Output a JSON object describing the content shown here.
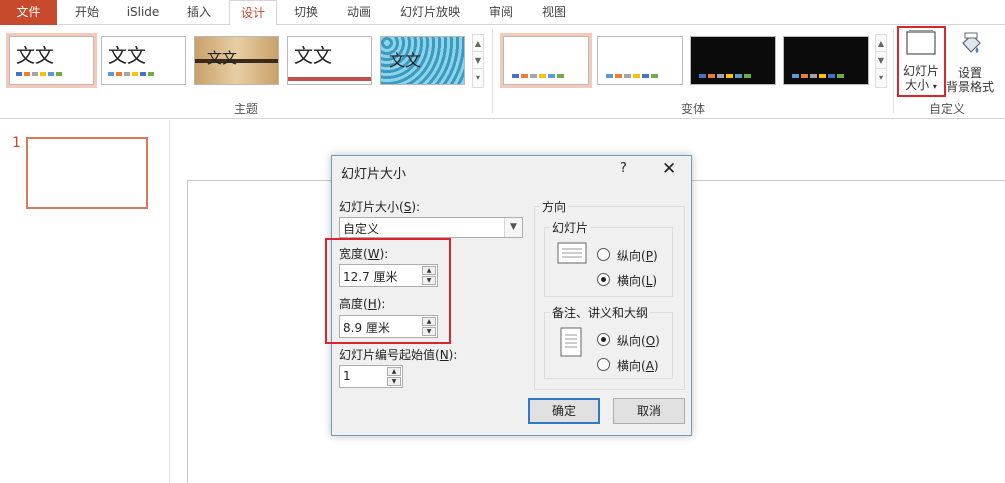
{
  "tabs": [
    "文件",
    "开始",
    "iSlide",
    "插入",
    "设计",
    "切换",
    "动画",
    "幻灯片放映",
    "审阅",
    "视图"
  ],
  "ribbon": {
    "themes_label": "主题",
    "variants_label": "变体",
    "customize_label": "自定义",
    "theme_sample_text": "文文",
    "slide_size_line1": "幻灯片",
    "slide_size_line2": "大小",
    "format_bg_line1": "设置",
    "format_bg_line2": "背景格式"
  },
  "slides": [
    {
      "number": "1"
    }
  ],
  "dialog": {
    "title": "幻灯片大小",
    "help": "?",
    "close": "✕",
    "size_label": "幻灯片大小(",
    "size_key": "S",
    "size_suffix": "):",
    "size_value": "自定义",
    "width_label": "宽度(",
    "width_key": "W",
    "width_suffix": "):",
    "width_value": "12.7 厘米",
    "height_label": "高度(",
    "height_key": "H",
    "height_suffix": "):",
    "height_value": "8.9 厘米",
    "number_label": "幻灯片编号起始值(",
    "number_key": "N",
    "number_suffix": "):",
    "number_value": "1",
    "orientation_label": "方向",
    "slides_group": "幻灯片",
    "portrait_p": "纵向(",
    "portrait_p_key": "P",
    "landscape_l": "横向(",
    "landscape_l_key": "L",
    "notes_group": "备注、讲义和大纲",
    "portrait_o": "纵向(",
    "portrait_o_key": "O",
    "landscape_a": "横向(",
    "landscape_a_key": "A",
    "close_paren": ")",
    "ok": "确定",
    "cancel": "取消"
  },
  "colors": {
    "accent": "#c64a2b",
    "highlight": "#d9252b",
    "dialog_border": "#6e9cc9",
    "default_button": "#2f79c6"
  }
}
